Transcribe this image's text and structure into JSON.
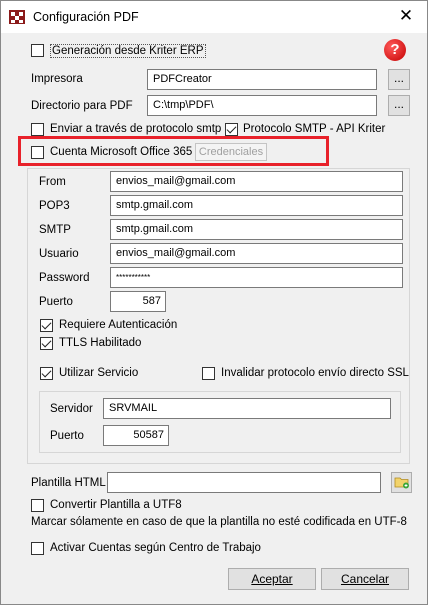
{
  "window": {
    "title": "Configuración PDF",
    "close_glyph": "✕"
  },
  "header": {
    "kriter_erp_label": "Generación desde Kriter ERP",
    "kriter_erp_checked": false,
    "help_glyph": "?"
  },
  "fields": {
    "printer_label": "Impresora",
    "printer_value": "PDFCreator",
    "dir_label": "Directorio para PDF",
    "dir_value": "C:\\tmp\\PDF\\",
    "browse_label": "..."
  },
  "smtp_options": {
    "send_smtp_label": "Enviar a través de protocolo smtp",
    "send_smtp_checked": false,
    "smtp_api_label": "Protocolo SMTP - API Kriter",
    "smtp_api_checked": true
  },
  "office365": {
    "label": "Cuenta Microsoft Office 365",
    "checked": false,
    "credentials_button": "Credenciales"
  },
  "mail": {
    "from_label": "From",
    "from_value": "envios_mail@gmail.com",
    "pop3_label": "POP3",
    "pop3_value": "smtp.gmail.com",
    "smtp_label": "SMTP",
    "smtp_value": "smtp.gmail.com",
    "user_label": "Usuario",
    "user_value": "envios_mail@gmail.com",
    "password_label": "Password",
    "password_value": "***********",
    "port_label": "Puerto",
    "port_value": "587",
    "requires_auth_label": "Requiere Autenticación",
    "requires_auth_checked": true,
    "ttls_label": "TTLS Habilitado",
    "ttls_checked": true,
    "use_service_label": "Utilizar Servicio",
    "use_service_checked": true,
    "invalidate_ssl_label": "Invalidar protocolo envío directo SSL",
    "invalidate_ssl_checked": false
  },
  "service": {
    "server_label": "Servidor",
    "server_value": "SRVMAIL",
    "port_label": "Puerto",
    "port_value": "50587"
  },
  "template": {
    "html_label": "Plantilla HTML",
    "html_value": "",
    "utf8_label": "Convertir Plantilla a UTF8",
    "utf8_checked": false,
    "utf8_note": "Marcar sólamente en caso de que la plantilla no esté codificada en UTF-8",
    "work_center_label": "Activar Cuentas según Centro de Trabajo",
    "work_center_checked": false
  },
  "footer": {
    "accept_label": "Aceptar",
    "cancel_label": "Cancelar"
  },
  "colors": {
    "highlight": "#e8212a",
    "help_red": "#c40000",
    "background": "#f0f0f0"
  }
}
